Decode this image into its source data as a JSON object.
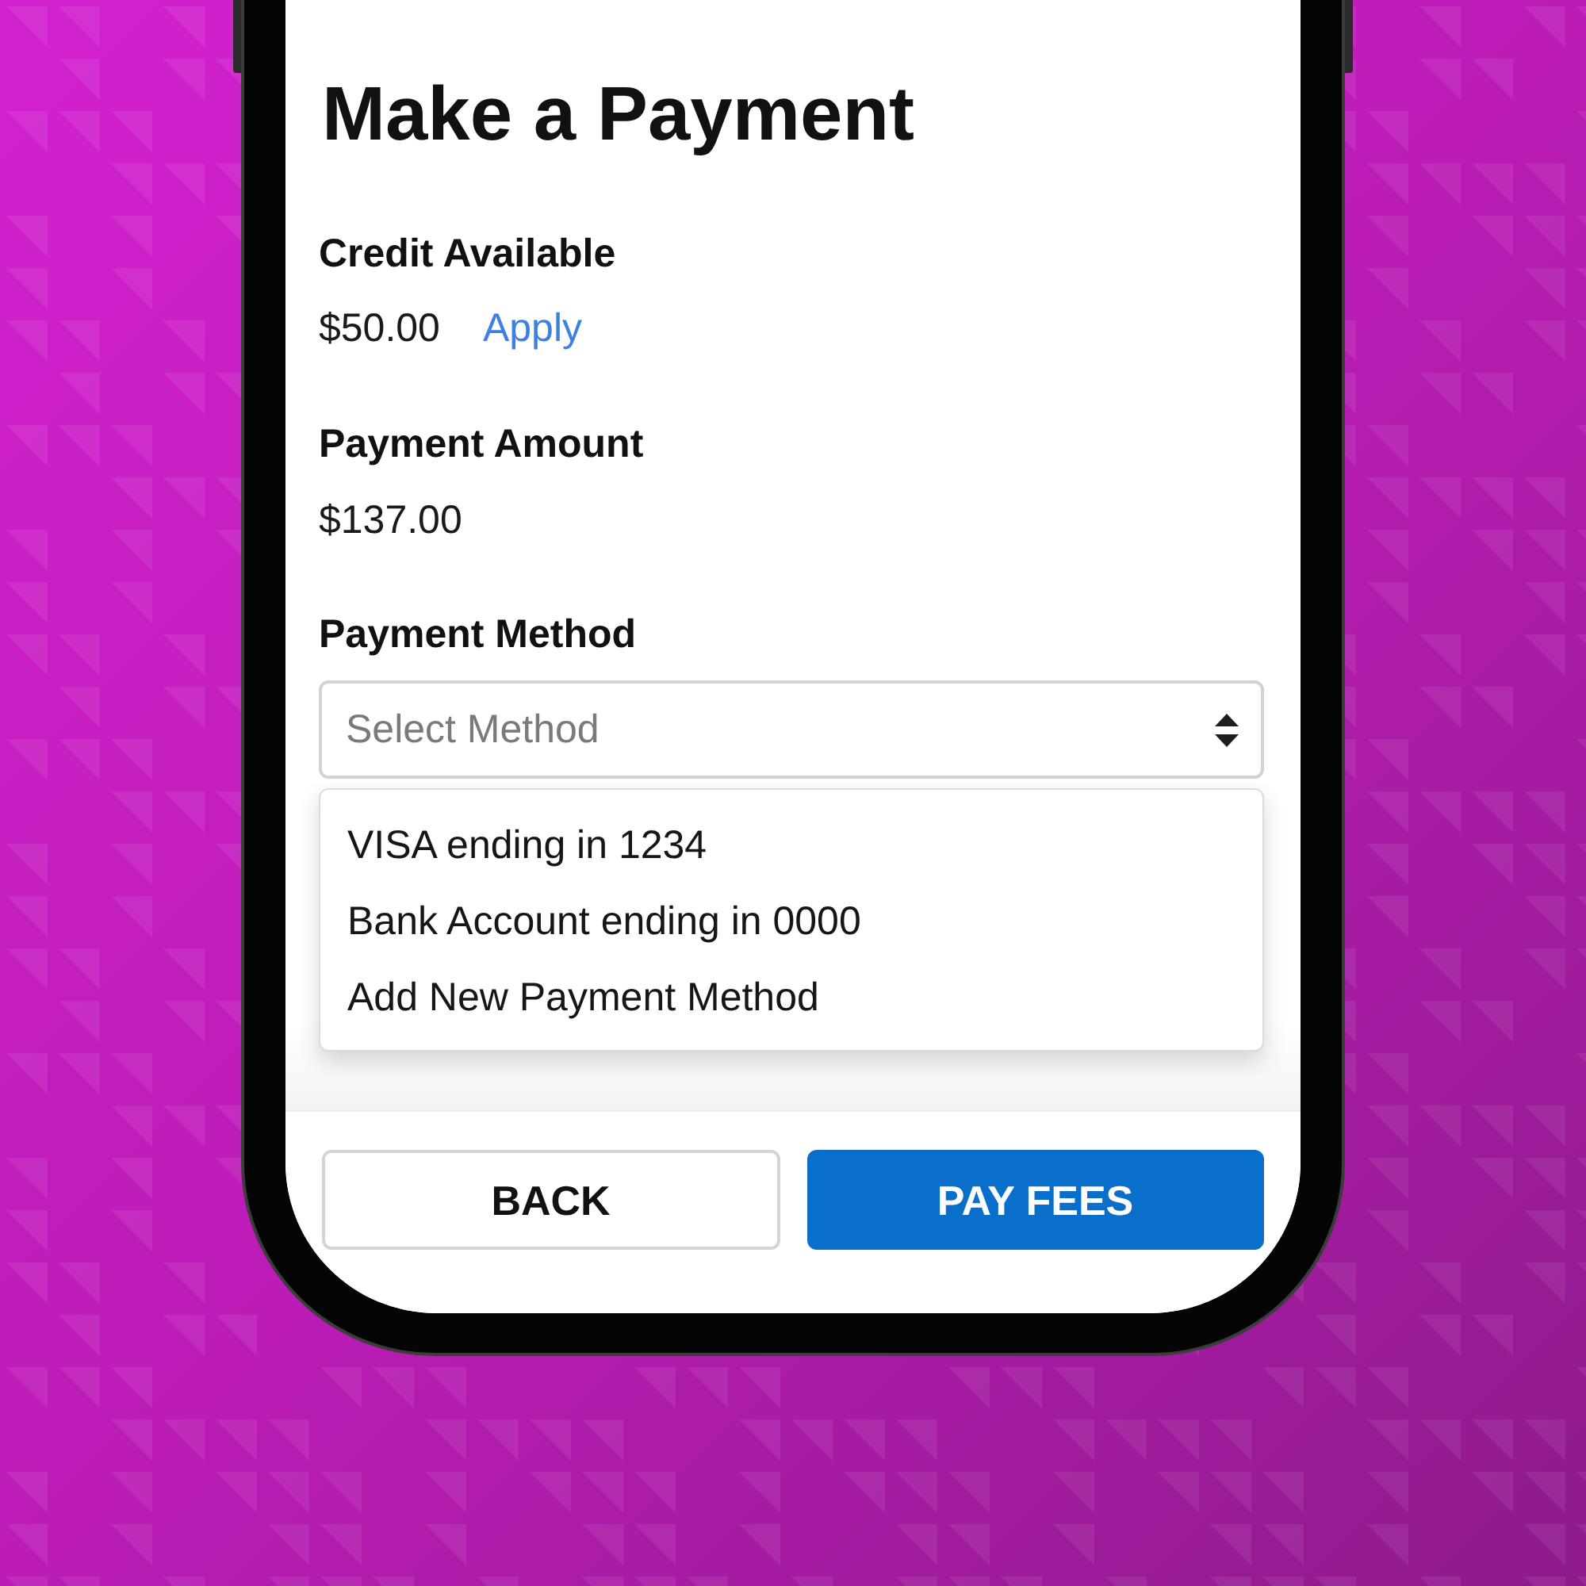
{
  "screen": {
    "title": "Make a Payment"
  },
  "credit": {
    "label": "Credit Available",
    "amount": "$50.00",
    "action": "Apply"
  },
  "payment_amount": {
    "label": "Payment Amount",
    "amount": "$137.00"
  },
  "payment_method": {
    "label": "Payment Method",
    "select": {
      "placeholder": "Select Method",
      "expanded": true
    },
    "options": [
      {
        "label": "VISA ending in 1234",
        "selected": false
      },
      {
        "label": "Bank Account ending in 0000",
        "selected": false
      },
      {
        "label": "Add New Payment Method",
        "selected": false
      }
    ]
  },
  "footer": {
    "buttons": [
      {
        "label": "BACK",
        "kind": "secondary"
      },
      {
        "label": "PAY FEES",
        "kind": "primary"
      }
    ]
  }
}
